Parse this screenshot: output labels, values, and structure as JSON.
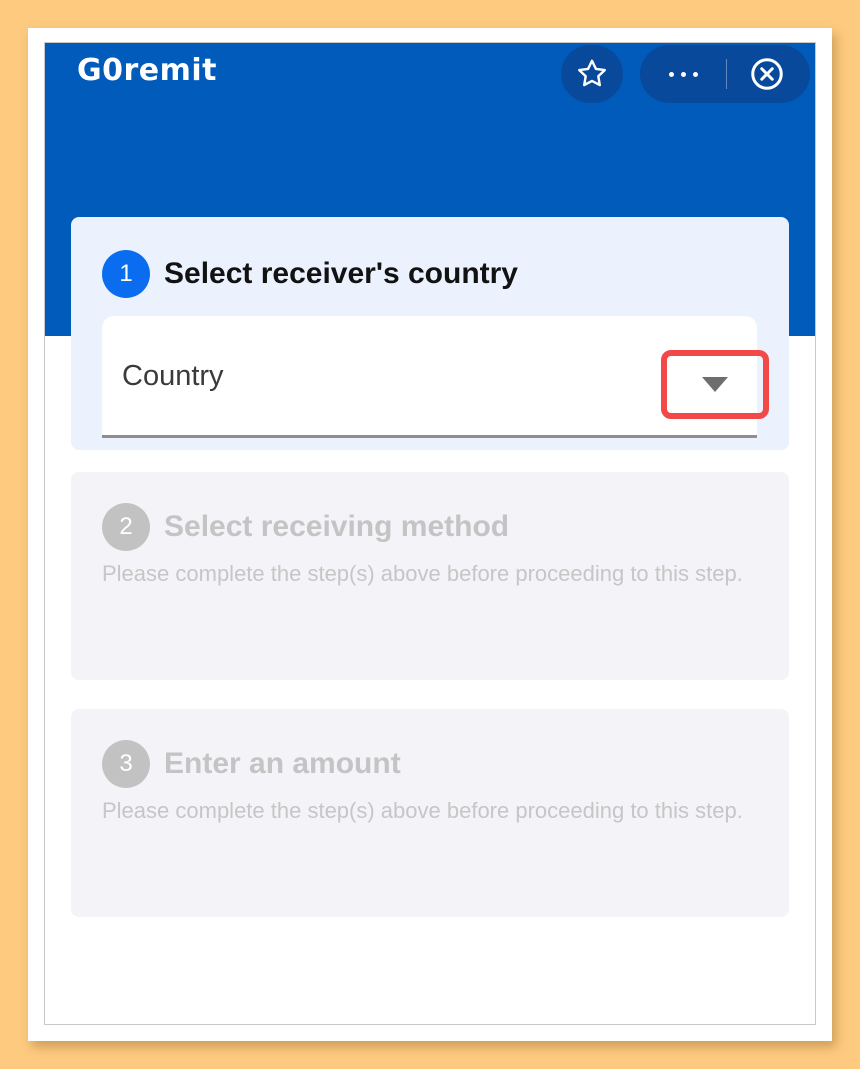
{
  "app": {
    "logo_text": "G0remit"
  },
  "toolbar": {
    "star_icon": "star-outline-icon",
    "more_icon": "more-horizontal-icon",
    "close_icon": "close-circle-icon"
  },
  "colors": {
    "header": "#005bbb",
    "toolbar_button": "#08499b",
    "active_step": "#0a6df0",
    "inactive_step": "#c2c2c2",
    "highlight_box": "#f24848",
    "page_background": "#fdca7f"
  },
  "steps": [
    {
      "number": "1",
      "title": "Select receiver's country",
      "state": "active",
      "field": {
        "label": "Country",
        "icon": "dropdown-arrow-icon"
      }
    },
    {
      "number": "2",
      "title": "Select receiving method",
      "state": "disabled",
      "description": "Please complete the step(s) above before proceeding to this step."
    },
    {
      "number": "3",
      "title": "Enter an amount",
      "state": "disabled",
      "description": "Please complete the step(s) above before proceeding to this step."
    }
  ]
}
